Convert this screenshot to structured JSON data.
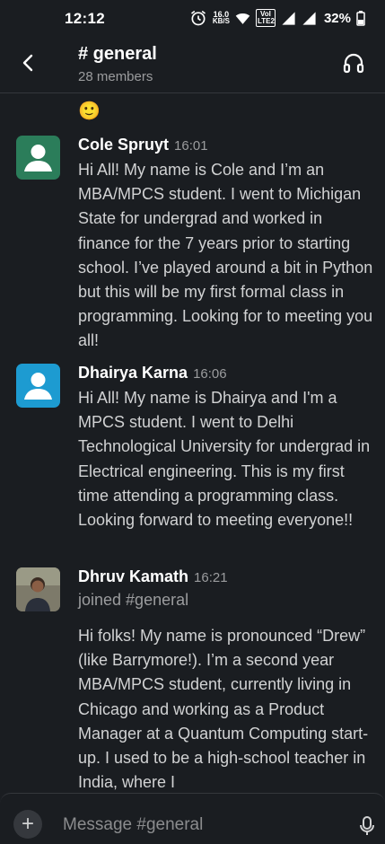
{
  "status_bar": {
    "time": "12:12",
    "net_speed_value": "16.0",
    "net_speed_unit": "KB/S",
    "volte_line1": "VoI",
    "volte_line2": "LTE2",
    "battery": "32%"
  },
  "header": {
    "channel": "# general",
    "members": "28 members"
  },
  "feed": {
    "top_reaction": "🙂",
    "messages": [
      {
        "sender": "Cole Spruyt",
        "time": "16:01",
        "text": "Hi All! My name is Cole and I’m an MBA/MPCS student. I went to Michigan State for undergrad and worked in finance for the 7 years prior to starting school. I’ve played around a bit in Python but this will be my first formal class in programming. Looking for to meeting you all!"
      },
      {
        "sender": "Dhairya Karna",
        "time": "16:06",
        "text": "Hi All! My name is Dhairya and I'm a MPCS student. I went to Delhi Technological University for undergrad in Electrical engineering. This is my first time attending a programming class. Looking forward to meeting everyone!!"
      },
      {
        "sender": "Dhruv Kamath",
        "time": "16:21",
        "joined": "joined #general",
        "text": "Hi folks! My name is pronounced “Drew” (like Barrymore!). I’m a second year MBA/MPCS student, currently living in Chicago and working as a Product Manager at a Quantum Computing start-up. I used to be a high-school teacher in India, where I"
      }
    ]
  },
  "composer": {
    "plus": "+",
    "placeholder": "Message #general"
  },
  "colors": {
    "background": "#1a1d21",
    "avatar_green": "#2b7d5a",
    "avatar_blue": "#1d9bd1",
    "text_primary": "#ffffff",
    "text_secondary": "#9b9c9e"
  },
  "icons": [
    "alarm-icon",
    "wifi-icon",
    "signal-icon",
    "battery-icon",
    "back-arrow-icon",
    "headphones-icon",
    "user-silhouette-icon",
    "plus-icon",
    "microphone-icon"
  ]
}
